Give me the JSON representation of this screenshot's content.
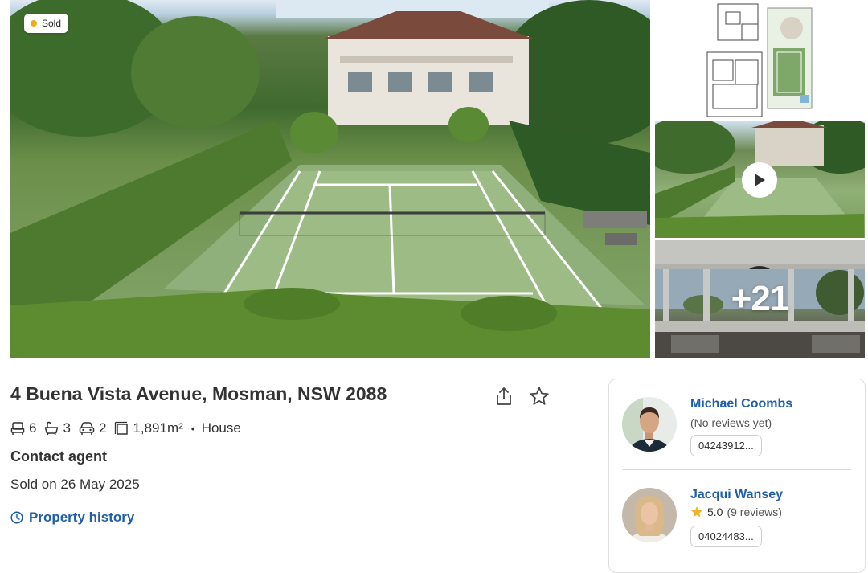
{
  "listing": {
    "status_badge": "Sold",
    "more_photos_label": "+21",
    "address": "4 Buena Vista Avenue, Mosman, NSW 2088",
    "features": {
      "bedrooms": "6",
      "bathrooms": "3",
      "parking": "2",
      "land_size": "1,891m²",
      "separator": "•",
      "property_type": "House"
    },
    "price_text": "Contact agent",
    "sold_date": "Sold on 26 May 2025",
    "property_history_label": "Property history"
  },
  "agents": [
    {
      "name": "Michael Coombs",
      "reviews": "(No reviews yet)",
      "phone": "04243912..."
    },
    {
      "name": "Jacqui Wansey",
      "rating": "5.0",
      "reviews": "(9 reviews)",
      "phone": "04024483..."
    }
  ],
  "colors": {
    "link_blue": "#1f5ea8",
    "sold_dot": "#f0a81e",
    "star": "#f0b429"
  }
}
